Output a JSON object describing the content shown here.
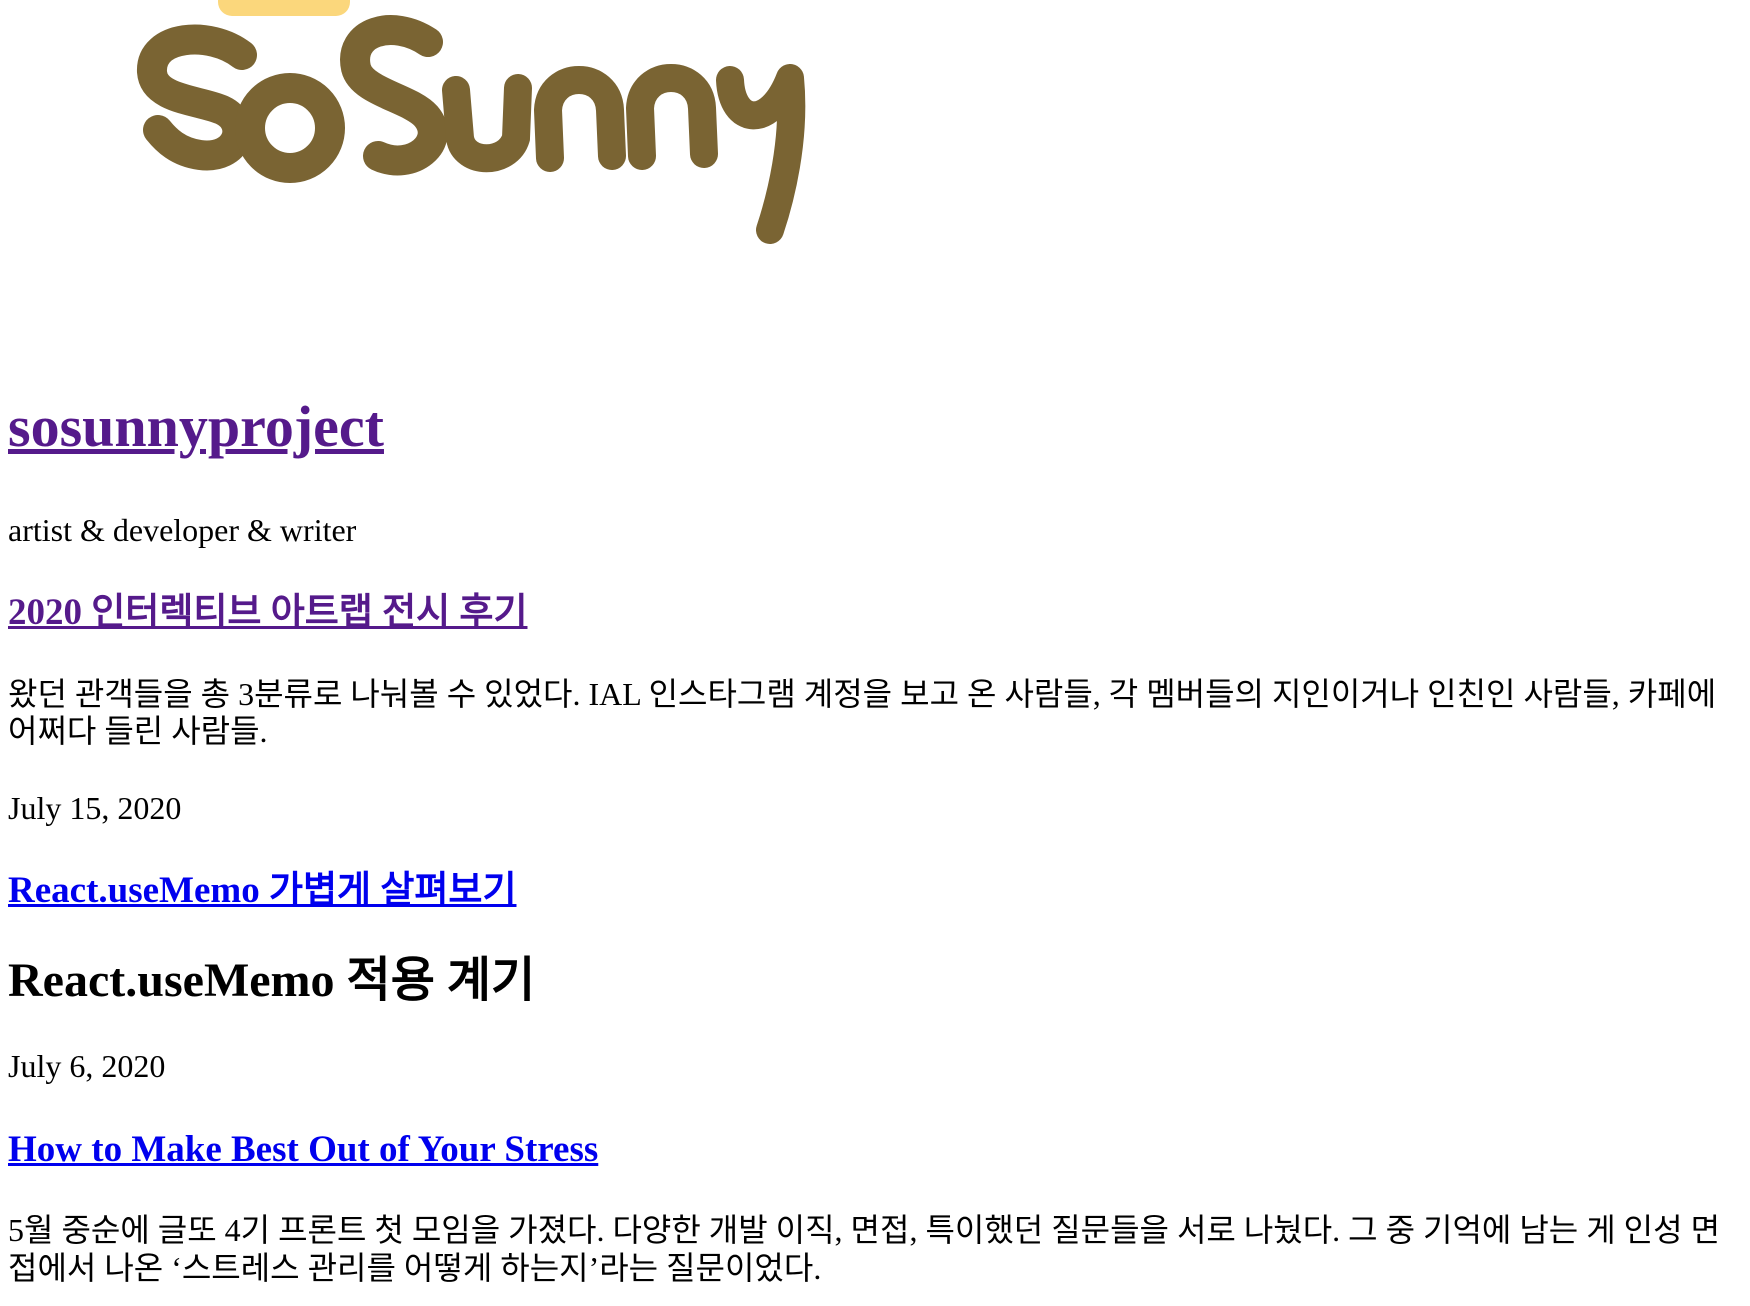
{
  "header": {
    "logo_text": "SoSunny",
    "site_title": "sosunnyproject",
    "tagline": "artist & developer & writer"
  },
  "posts": [
    {
      "title": "2020 인터렉티브 아트랩 전시 후기",
      "excerpt": "왔던 관객들을 총 3분류로 나눠볼 수 있었다. IAL 인스타그램 계정을 보고 온 사람들, 각 멤버들의 지인이거나 인친인 사람들, 카페에 어쩌다 들린 사람들.",
      "date": "July 15, 2020"
    },
    {
      "title": "React.useMemo 가볍게 살펴보기",
      "heading": "React.useMemo 적용 계기",
      "date": "July 6, 2020"
    },
    {
      "title": "How to Make Best Out of Your Stress",
      "excerpt": "5월 중순에 글또 4기 프론트 첫 모임을 가졌다. 다양한 개발 이직, 면접, 특이했던 질문들을 서로 나눴다. 그 중 기억에 남는 게 인성 면접에서 나온 ‘스트레스 관리를 어떻게 하는지’라는 질문이었다."
    }
  ],
  "colors": {
    "visited_link": "#551a8b",
    "link": "#0000ee",
    "logo_brown": "#7a6433",
    "logo_sun": "#fbd77c"
  }
}
